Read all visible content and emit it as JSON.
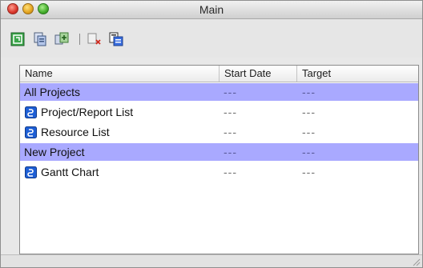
{
  "window": {
    "title": "Main"
  },
  "toolbar": {
    "buttons": [
      {
        "icon": "refresh-icon"
      },
      {
        "icon": "copy-icon"
      },
      {
        "icon": "add-item-icon"
      },
      {
        "icon": "delete-icon"
      },
      {
        "icon": "document-properties-icon"
      }
    ]
  },
  "table": {
    "columns": [
      "Name",
      "Start Date",
      "Target"
    ],
    "rows": [
      {
        "name": "All Projects",
        "start": "---",
        "target": "---",
        "group": true
      },
      {
        "name": "Project/Report List",
        "start": "---",
        "target": "---",
        "group": false
      },
      {
        "name": "Resource List",
        "start": "---",
        "target": "---",
        "group": false
      },
      {
        "name": "New Project",
        "start": "---",
        "target": "---",
        "group": true
      },
      {
        "name": "Gantt Chart",
        "start": "---",
        "target": "---",
        "group": false
      }
    ]
  },
  "colors": {
    "group_row": "#a9a9ff",
    "item_icon": "#1e5fd6"
  }
}
